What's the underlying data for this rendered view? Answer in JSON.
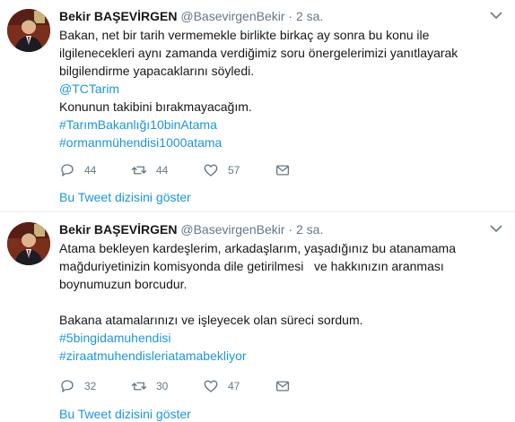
{
  "tweets": [
    {
      "name": "Bekir BAŞEVİRGEN",
      "handle": "@BasevirgenBekir",
      "separator": "·",
      "time": "2 sa.",
      "lines": [
        {
          "text": "Bakan, net bir tarih vermemekle birlikte birkaç ay sonra bu konu ile",
          "link": false
        },
        {
          "text": "ilgilenecekleri aynı zamanda verdiğimiz soru önergelerimizi yanıtlayarak",
          "link": false
        },
        {
          "text": "bilgilendirme yapacaklarını söyledi.",
          "link": false
        },
        {
          "text": "@TCTarim",
          "link": true
        },
        {
          "text": "Konunun takibini bırakmayacağım.",
          "link": false
        },
        {
          "text": "#TarımBakanlığı10binAtama",
          "link": true
        },
        {
          "text": "#ormanmühendisi1000atama",
          "link": true
        }
      ],
      "replies": "44",
      "retweets": "44",
      "likes": "57",
      "thread_label": "Bu Tweet dizisini göster"
    },
    {
      "name": "Bekir BAŞEVİRGEN",
      "handle": "@BasevirgenBekir",
      "separator": "·",
      "time": "2 sa.",
      "lines": [
        {
          "text": "Atama bekleyen kardeşlerim, arkadaşlarım, yaşadığınız bu atanamama",
          "link": false
        },
        {
          "text": "mağduriyetinizin komisyonda dile getirilmesi   ve hakkınızın aranması",
          "link": false
        },
        {
          "text": "boynumuzun borcudur.",
          "link": false
        },
        {
          "text": "",
          "link": false
        },
        {
          "text": "Bakana atamalarınızı ve işleyecek olan süreci sordum.",
          "link": false
        },
        {
          "text": "#5bingidamuhendisi",
          "link": true
        },
        {
          "text": "#ziraatmuhendisleriatamabekliyor",
          "link": true
        }
      ],
      "replies": "32",
      "retweets": "30",
      "likes": "47",
      "thread_label": "Bu Tweet dizisini göster"
    }
  ],
  "colors": {
    "text": "#14171a",
    "muted": "#657786",
    "link": "#1b95e0",
    "divider": "#e6ecf0"
  }
}
